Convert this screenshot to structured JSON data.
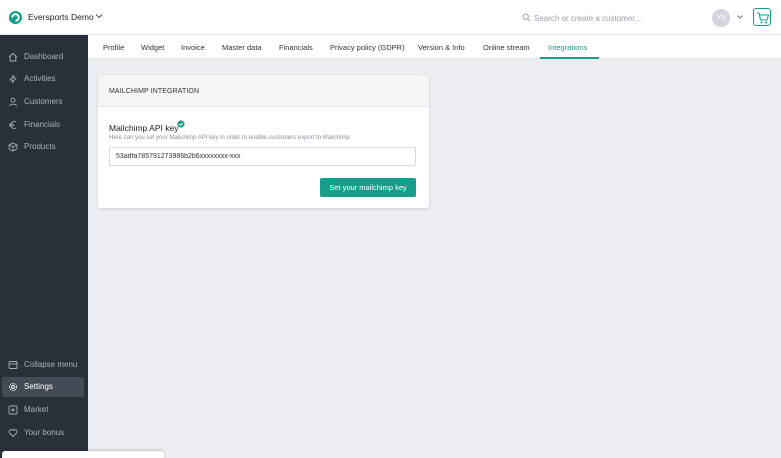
{
  "header": {
    "org_name": "Eversports Demo",
    "search_placeholder": "Search or create a customer...",
    "avatar_initials": "VV",
    "brand_color": "#1a9c8a"
  },
  "sidebar": {
    "items": [
      {
        "label": "Dashboard",
        "icon": "home-icon"
      },
      {
        "label": "Activities",
        "icon": "activity-icon"
      },
      {
        "label": "Customers",
        "icon": "user-icon"
      },
      {
        "label": "Financials",
        "icon": "euro-icon"
      },
      {
        "label": "Products",
        "icon": "box-icon"
      }
    ],
    "bottom_items": [
      {
        "label": "Collapse menu",
        "icon": "collapse-icon"
      },
      {
        "label": "Settings",
        "icon": "gear-icon",
        "active": true
      },
      {
        "label": "Market",
        "icon": "market-icon"
      },
      {
        "label": "Your bonus",
        "icon": "heart-icon"
      }
    ]
  },
  "tabs": [
    {
      "label": "Profile"
    },
    {
      "label": "Widget"
    },
    {
      "label": "Invoice"
    },
    {
      "label": "Master data"
    },
    {
      "label": "Financials"
    },
    {
      "label": "Privacy policy (GDPR)"
    },
    {
      "label": "Version & Info"
    },
    {
      "label": "Online stream"
    },
    {
      "label": "Integrations",
      "active": true
    }
  ],
  "mailchimp": {
    "title": "MAILCHIMP INTEGRATION",
    "field_label": "Mailchimp API key",
    "help_text": "Here can you set your Mailchimp API key in order to enable customers export to Mailchimp",
    "api_key_value": "53adfa785791273986b2b6xxxxxxxx-xxx",
    "button_label": "Set your mailchimp key"
  }
}
